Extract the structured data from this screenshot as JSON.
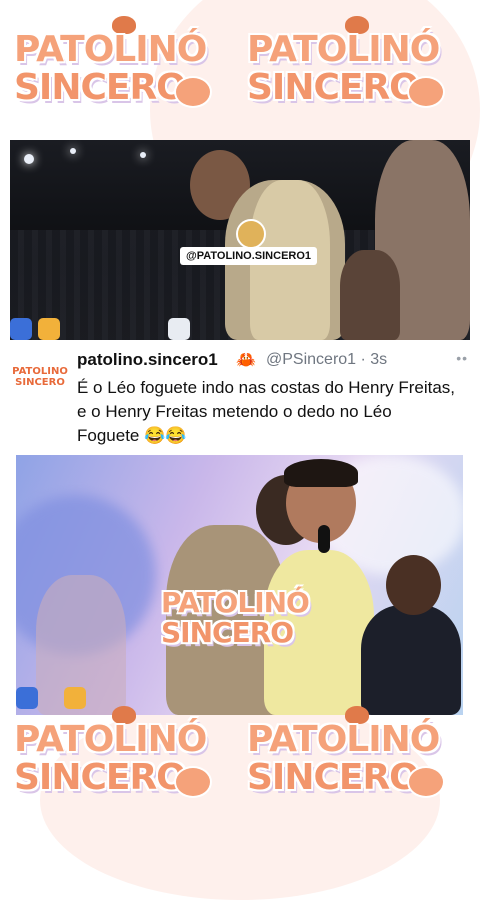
{
  "watermark": {
    "line1": "PATOLINÓ",
    "line2": "SINCERO"
  },
  "top_photo": {
    "overlay_handle": "@PATOLINO.SINCERO1"
  },
  "post": {
    "avatar_line1": "PATOLINÓ",
    "avatar_line2": "SINCERO",
    "username": "patolino.sincero1",
    "crab_emoji": "🦀",
    "handle_time": "@PSincero1 · 3s",
    "more": "••",
    "text": "É o Léo foguete indo nas costas do Henry Freitas, e o Henry Freitas metendo o dedo no Léo Foguete 😂😂"
  },
  "main_photo": {
    "watermark_line1": "PATOLINÓ",
    "watermark_line2": "SINCERO"
  },
  "colors": {
    "logo_orange": "#f5a27a",
    "tank_top": "#efe8a0",
    "shirt": "#1c1f2a"
  }
}
